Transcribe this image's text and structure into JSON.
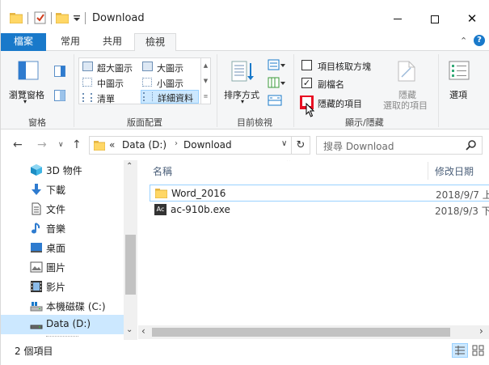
{
  "window": {
    "title": "Download",
    "minimize_icon": "minimize-icon",
    "maximize_icon": "maximize-icon",
    "close_icon": "close-icon"
  },
  "quick_access": {
    "icons": [
      "folder-icon",
      "properties-checkmark-icon",
      "new-folder-icon",
      "dropdown-arrow-icon"
    ]
  },
  "ribbon_tabs": [
    {
      "label": "檔案"
    },
    {
      "label": "常用"
    },
    {
      "label": "共用"
    },
    {
      "label": "檢視",
      "active": true
    }
  ],
  "ribbon": {
    "pane_group": {
      "nav_pane_label": "瀏覽窗格",
      "group_label": "窗格"
    },
    "layout_group": {
      "options": [
        "超大圖示",
        "大圖示",
        "中圖示",
        "小圖示",
        "清單",
        "詳細資料"
      ],
      "selected": "詳細資料",
      "group_label": "版面配置"
    },
    "current_view_group": {
      "sort_label": "排序方式",
      "group_label": "目前檢視"
    },
    "show_hide_group": {
      "item_checkbox_label": "項目核取方塊",
      "item_checkbox_checked": false,
      "extensions_label": "副檔名",
      "extensions_checked": true,
      "hidden_items_label": "隱藏的項目",
      "hidden_items_checked": false,
      "hide_selected_label_1": "隱藏",
      "hide_selected_label_2": "選取的項目",
      "group_label": "顯示/隱藏"
    },
    "options_label": "選項"
  },
  "address": {
    "prefix": "«",
    "path": [
      "Data (D:)",
      "Download"
    ],
    "search_placeholder": "搜尋 Download"
  },
  "nav_pane": {
    "items": [
      {
        "label": "3D 物件",
        "icon": "3d-objects-icon"
      },
      {
        "label": "下載",
        "icon": "download-arrow-icon"
      },
      {
        "label": "文件",
        "icon": "document-icon"
      },
      {
        "label": "音樂",
        "icon": "music-note-icon"
      },
      {
        "label": "桌面",
        "icon": "desktop-icon"
      },
      {
        "label": "圖片",
        "icon": "pictures-icon"
      },
      {
        "label": "影片",
        "icon": "video-icon"
      },
      {
        "label": "本機磁碟 (C:)",
        "icon": "drive-icon"
      },
      {
        "label": "Data (D:)",
        "icon": "drive-icon",
        "selected": true
      }
    ]
  },
  "file_list": {
    "columns": [
      "名稱",
      "修改日期"
    ],
    "rows": [
      {
        "name": "Word_2016",
        "date": "2018/9/7 上",
        "icon": "folder-icon"
      },
      {
        "name": "ac-910b.exe",
        "date": "2018/9/3 下",
        "icon": "exe-icon"
      }
    ]
  },
  "status": {
    "count": "2 個項目"
  },
  "colors": {
    "accent": "#1979ca",
    "selection": "#cce8ff",
    "folder": "#ffd766",
    "highlight_box": "#e81123"
  }
}
